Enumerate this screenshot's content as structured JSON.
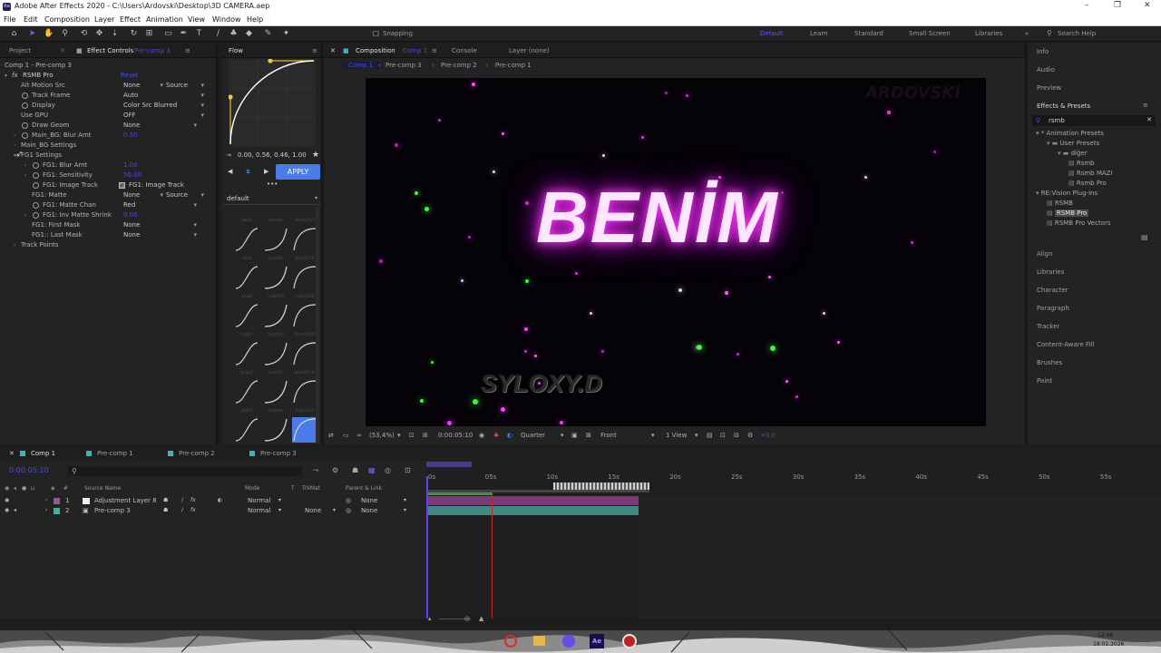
{
  "window": {
    "title": "Adobe After Effects 2020 - C:\\Users\\Ardovski\\Desktop\\3D CAMERA.aep",
    "logo": "Ae",
    "controls": [
      "–",
      "❐",
      "✕"
    ]
  },
  "menu": [
    "File",
    "Edit",
    "Composition",
    "Layer",
    "Effect",
    "Animation",
    "View",
    "Window",
    "Help"
  ],
  "toolbar": {
    "snapping_label": "Snapping",
    "workspaces": [
      {
        "label": "Default",
        "active": true
      },
      {
        "label": "Learn",
        "active": false
      },
      {
        "label": "Standard",
        "active": false
      },
      {
        "label": "Small Screen",
        "active": false
      },
      {
        "label": "Libraries",
        "active": false
      }
    ],
    "search_placeholder": "Search Help"
  },
  "left_panel": {
    "tabs": [
      "Project",
      "Effect Controls"
    ],
    "tab_suffix": "Pre-comp 3",
    "breadcrumb": "Comp 1 - Pre-comp 3",
    "effect_name": "RSMB Pro",
    "reset_label": "Reset",
    "properties": [
      {
        "label": "Alt Motion Src",
        "value": "None",
        "value2": "Source"
      },
      {
        "label": "Track Frame",
        "value": "Auto"
      },
      {
        "label": "Display",
        "value": "Color Src Blurred"
      },
      {
        "label": "Use GPU",
        "value": "OFF"
      },
      {
        "label": "Draw Geom",
        "value": "None"
      },
      {
        "label": "Main_BG: Blur Amt",
        "value": "0.50"
      },
      {
        "label": "Main_BG Settings",
        "value": ""
      },
      {
        "label": "FG1 Settings",
        "value": ""
      },
      {
        "label": "FG1: Blur Amt",
        "value": "1.00"
      },
      {
        "label": "FG1: Sensitivity",
        "value": "50.00"
      },
      {
        "label": "FG1: Image Track",
        "value": "FG1: Image Track"
      },
      {
        "label": "FG1: Matte",
        "value": "None",
        "value2": "Source"
      },
      {
        "label": "FG1: Matte Chan",
        "value": "Red"
      },
      {
        "label": "FG1: Inv Matte Shrink",
        "value": "0.00"
      },
      {
        "label": "FG1: First Mask",
        "value": "None"
      },
      {
        "label": "FG1:: Last Mask",
        "value": "None"
      },
      {
        "label": "Track Points",
        "value": ""
      }
    ]
  },
  "flow": {
    "tab": "Flow",
    "bezier_value": "0.00, 0.56, 0.46, 1.00",
    "apply_label": "APPLY",
    "preset_label": "default",
    "more": "•••",
    "curve_labels": [
      "ease",
      "easeIn",
      "easeOut",
      "sine",
      "quadIn",
      "quadOut",
      "quad",
      "cubicIn",
      "cubicOut",
      "cubic",
      "quartIn",
      "quartOut",
      "quart",
      "quintIn",
      "quintOut",
      "quint",
      "expoIn",
      "expoOut"
    ]
  },
  "comp_panel": {
    "tabs": [
      "Composition",
      "Console",
      "Layer (none)"
    ],
    "comp_tab_suffix": "Comp 1",
    "breadcrumbs": [
      "Comp 1",
      "Pre-comp 3",
      "Pre-comp 2",
      "Pre-comp 1"
    ],
    "viewer_title": "BENİM",
    "viewer_subtitle": "SYLOXY.D",
    "watermark": "ARDOVSKİ",
    "zoom": "(53,4%)",
    "timecode": "0:00:05:10",
    "resolution": "Quarter",
    "view": "Front",
    "views_count": "1 View",
    "exposure": "+0.0"
  },
  "right_panel": {
    "sections_top": [
      "Info",
      "Audio",
      "Preview"
    ],
    "effects_presets_title": "Effects & Presets",
    "search_value": "rsmb",
    "tree": [
      {
        "label": "* Animation Presets",
        "indent": 0
      },
      {
        "label": "User Presets",
        "indent": 1
      },
      {
        "label": "diğer",
        "indent": 2
      },
      {
        "label": "Rsmb",
        "indent": 3
      },
      {
        "label": "Rsmb MAZI",
        "indent": 3
      },
      {
        "label": "Rsmb Pro",
        "indent": 3
      },
      {
        "label": "RE:Vision Plug-ins",
        "indent": 0
      },
      {
        "label": "RSMB",
        "indent": 1
      },
      {
        "label": "RSMB Pro",
        "indent": 1,
        "selected": true
      },
      {
        "label": "RSMB Pro Vectors",
        "indent": 1
      }
    ],
    "sections_bottom": [
      "Align",
      "Libraries",
      "Character",
      "Paragraph",
      "Tracker",
      "Content-Aware Fill",
      "Brushes",
      "Paint"
    ]
  },
  "timeline": {
    "tabs": [
      {
        "label": "Comp 1",
        "color": "#3cb4b4",
        "active": true
      },
      {
        "label": "Pre-comp 1",
        "color": "#3cb4b4",
        "active": false
      },
      {
        "label": "Pre-comp 2",
        "color": "#3cb4b4",
        "active": false
      },
      {
        "label": "Pre-comp 3",
        "color": "#3cb4b4",
        "active": false
      }
    ],
    "current_time": "0:00:05:10",
    "columns": {
      "source": "Source Name",
      "mode": "Mode",
      "t": "T",
      "trkmat": "TrkMat",
      "parent": "Parent & Link"
    },
    "ruler": [
      "0s",
      "05s",
      "10s",
      "15s",
      "20s",
      "25s",
      "30s",
      "35s",
      "40s",
      "45s",
      "50s",
      "55s"
    ],
    "layers": [
      {
        "num": "1",
        "name": "Adjustment Layer 8",
        "mode": "Normal",
        "trkmat": "",
        "parent": "None",
        "color": "#a050a0"
      },
      {
        "num": "2",
        "name": "Pre-comp 3",
        "mode": "Normal",
        "trkmat": "None",
        "parent": "None",
        "color": "#3cb4a0"
      }
    ]
  },
  "taskbar": {
    "time": "12:46",
    "date": "18.01.2026"
  }
}
